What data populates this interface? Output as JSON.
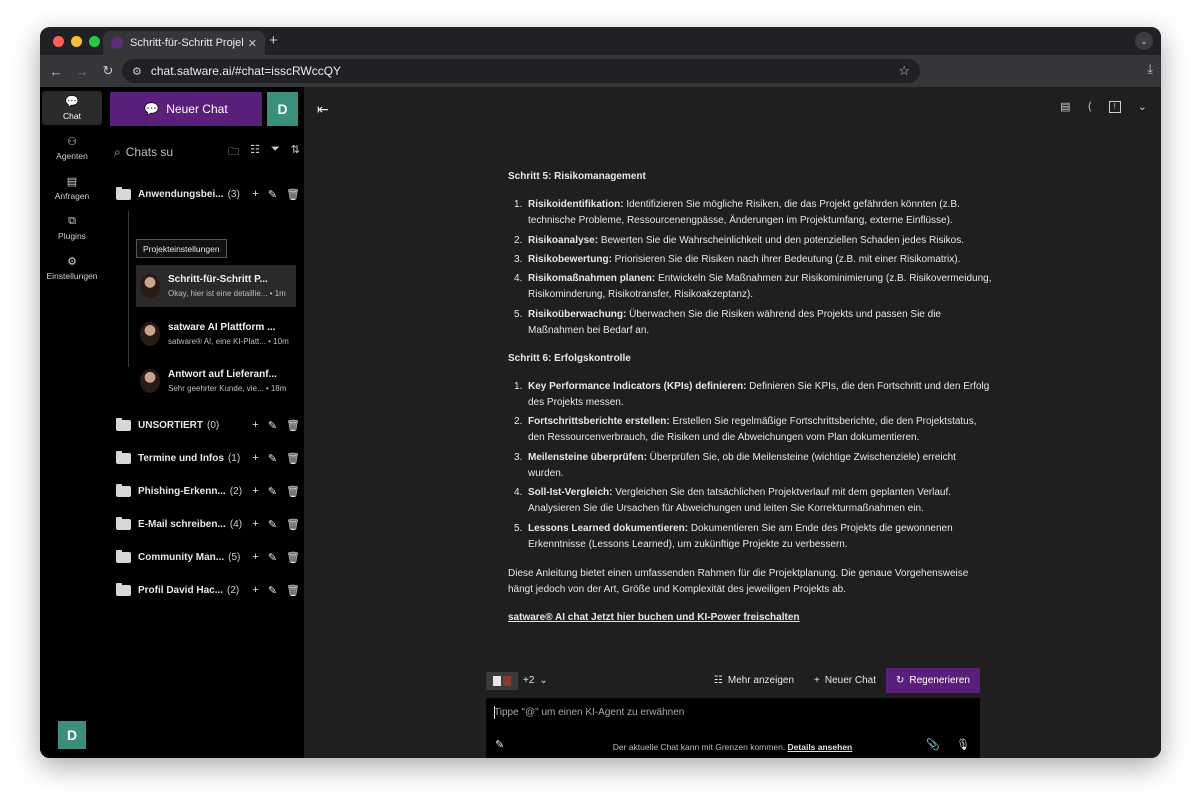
{
  "browser": {
    "tab_title": "Schritt-für-Schritt Projektplan",
    "tab_close": "✕",
    "new_tab": "+",
    "url": "chat.satware.ai/#chat=isscRWccQY"
  },
  "rail": {
    "items": [
      {
        "label": "Chat",
        "icon": "💬"
      },
      {
        "label": "Agenten",
        "icon": "⚇"
      },
      {
        "label": "Anfragen",
        "icon": "▤"
      },
      {
        "label": "Plugins",
        "icon": "⧉"
      },
      {
        "label": "Einstellungen",
        "icon": "⚙"
      }
    ],
    "avatar": "D"
  },
  "panel": {
    "new_chat_label": "Neuer Chat",
    "avatar": "D",
    "search_placeholder": "Chats su",
    "tooltip": "Projekteinstellungen",
    "folders": [
      {
        "name": "Anwendungsbei...",
        "count": "(3)"
      },
      {
        "name": "UNSORTIERT",
        "count": "(0)"
      },
      {
        "name": "Termine und Infos",
        "count": "(1)"
      },
      {
        "name": "Phishing-Erkenn...",
        "count": "(2)"
      },
      {
        "name": "E-Mail schreiben...",
        "count": "(4)"
      },
      {
        "name": "Community Man...",
        "count": "(5)"
      },
      {
        "name": "Profil David Hac...",
        "count": "(2)"
      }
    ],
    "chats": [
      {
        "title": "Schritt-für-Schritt P...",
        "snippet": "Okay, hier ist eine detaillie... • 1m"
      },
      {
        "title": "satware AI Plattform ...",
        "snippet": "satware® AI, eine KI-Platt... • 10m"
      },
      {
        "title": "Antwort auf Lieferanf...",
        "snippet": "Sehr geehrter Kunde, vie... • 18m"
      }
    ]
  },
  "content": {
    "section5_title": "Schritt 5: Risikomanagement",
    "section5_items": [
      {
        "n": "1.",
        "b": "Risikoidentifikation:",
        "t": " Identifizieren Sie mögliche Risiken, die das Projekt gefährden könnten (z.B. technische Probleme, Ressourcenengpässe, Änderungen im Projektumfang, externe Einflüsse)."
      },
      {
        "n": "2.",
        "b": "Risikoanalyse:",
        "t": " Bewerten Sie die Wahrscheinlichkeit und den potenziellen Schaden jedes Risikos."
      },
      {
        "n": "3.",
        "b": "Risikobewertung:",
        "t": " Priorisieren Sie die Risiken nach ihrer Bedeutung (z.B. mit einer Risikomatrix)."
      },
      {
        "n": "4.",
        "b": "Risikomaßnahmen planen:",
        "t": " Entwickeln Sie Maßnahmen zur Risikominimierung (z.B. Risikovermeidung, Risikominderung, Risikotransfer, Risikoakzeptanz)."
      },
      {
        "n": "5.",
        "b": "Risikoüberwachung:",
        "t": " Überwachen Sie die Risiken während des Projekts und passen Sie die Maßnahmen bei Bedarf an."
      }
    ],
    "section6_title": "Schritt 6: Erfolgskontrolle",
    "section6_items": [
      {
        "n": "1.",
        "b": "Key Performance Indicators (KPIs) definieren:",
        "t": " Definieren Sie KPIs, die den Fortschritt und den Erfolg des Projekts messen."
      },
      {
        "n": "2.",
        "b": "Fortschrittsberichte erstellen:",
        "t": " Erstellen Sie regelmäßige Fortschrittsberichte, die den Projektstatus, den Ressourcenverbrauch, die Risiken und die Abweichungen vom Plan dokumentieren."
      },
      {
        "n": "3.",
        "b": "Meilensteine überprüfen:",
        "t": " Überprüfen Sie, ob die Meilensteine (wichtige Zwischenziele) erreicht wurden."
      },
      {
        "n": "4.",
        "b": "Soll-Ist-Vergleich:",
        "t": " Vergleichen Sie den tatsächlichen Projektverlauf mit dem geplanten Verlauf. Analysieren Sie die Ursachen für Abweichungen und leiten Sie Korrekturmaßnahmen ein."
      },
      {
        "n": "5.",
        "b": "Lessons Learned dokumentieren:",
        "t": " Dokumentieren Sie am Ende des Projekts die gewonnenen Erkenntnisse (Lessons Learned), um zukünftige Projekte zu verbessern."
      }
    ],
    "closing": "Diese Anleitung bietet einen umfassenden Rahmen für die Projektplanung. Die genaue Vorgehensweise hängt jedoch von der Art, Größe und Komplexität des jeweiligen Projekts ab.",
    "link": "satware® AI chat Jetzt hier buchen und KI-Power freischalten"
  },
  "composer": {
    "agents_more": "+2",
    "more_label": "Mehr anzeigen",
    "new_chat_label": "Neuer Chat",
    "regen_label": "Regenerieren",
    "placeholder": "Tippe \"@\" um einen KI-Agent zu erwähnen"
  },
  "footer": {
    "note": "Der aktuelle Chat kann mit Grenzen kommen.",
    "link": "Details ansehen"
  },
  "colors": {
    "accent": "#5a1f7a",
    "avatar": "#3b8f7d"
  }
}
